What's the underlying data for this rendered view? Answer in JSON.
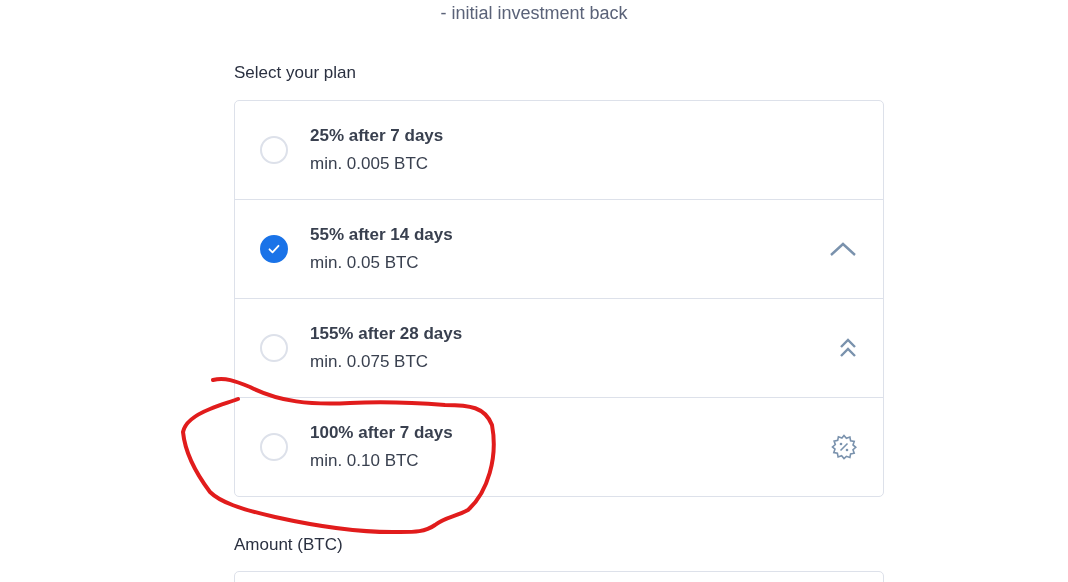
{
  "intro": "- initial investment back",
  "plan_label": "Select your plan",
  "plans": [
    {
      "title": "25% after 7 days",
      "minimum": "min. 0.005 BTC",
      "selected": false,
      "kind": "plain"
    },
    {
      "title": "55% after 14 days",
      "minimum": "min. 0.05 BTC",
      "selected": true,
      "kind": "chevron"
    },
    {
      "title": "155% after 28 days",
      "minimum": "min. 0.075 BTC",
      "selected": false,
      "kind": "double-chevron"
    },
    {
      "title": "100% after 7 days",
      "minimum": "min. 0.10 BTC",
      "selected": false,
      "kind": "percent-badge"
    }
  ],
  "amount": {
    "label": "Amount (BTC)"
  }
}
